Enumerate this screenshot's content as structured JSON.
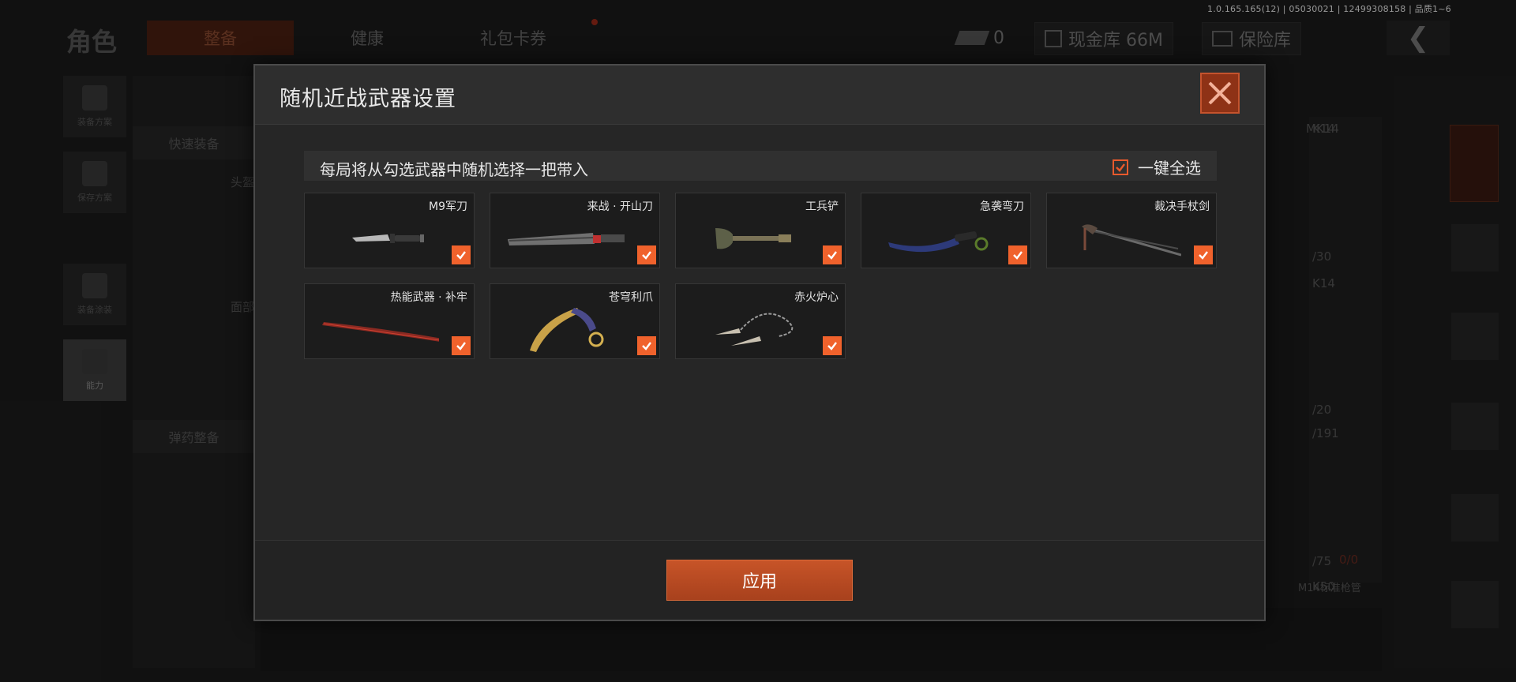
{
  "version": "1.0.165.165(12) | 05030021 | 12499308158 | 品质1~6",
  "background": {
    "title": "角色",
    "tabs": [
      "整备",
      "健康",
      "礼包卡券"
    ],
    "bill_count": "0",
    "cash_vault": "现金库 66M",
    "safe": "保险库",
    "left_nav": [
      "装备方案",
      "保存方案",
      "装备涂装",
      "能力"
    ],
    "panel_rows": [
      "快速装备",
      "弹药整备"
    ],
    "panel_labels": [
      "头盔",
      "面部"
    ],
    "right_texts": [
      "K14",
      "MK14",
      "/30",
      "K14",
      "/20",
      "/191",
      "/75",
      "0/0",
      "K50",
      "M14标准枪管"
    ]
  },
  "modal": {
    "title": "随机近战武器设置",
    "info_text": "每局将从勾选武器中随机选择一把带入",
    "select_all_label": "一键全选",
    "apply_label": "应用",
    "weapons": [
      {
        "name": "M9军刀",
        "checked": true,
        "icon": "combat-knife"
      },
      {
        "name": "来战 · 开山刀",
        "checked": true,
        "icon": "machete"
      },
      {
        "name": "工兵铲",
        "checked": true,
        "icon": "shovel"
      },
      {
        "name": "急袭弯刀",
        "checked": true,
        "icon": "curved-blade"
      },
      {
        "name": "裁决手杖剑",
        "checked": true,
        "icon": "cane-sword"
      },
      {
        "name": "热能武器 · 补牢",
        "checked": true,
        "icon": "katana"
      },
      {
        "name": "苍穹利爪",
        "checked": true,
        "icon": "karambit"
      },
      {
        "name": "赤火炉心",
        "checked": true,
        "icon": "chain-blades"
      }
    ]
  },
  "colors": {
    "accent": "#f0622c",
    "close_bg": "#8e3216",
    "apply": "#b84a22"
  }
}
